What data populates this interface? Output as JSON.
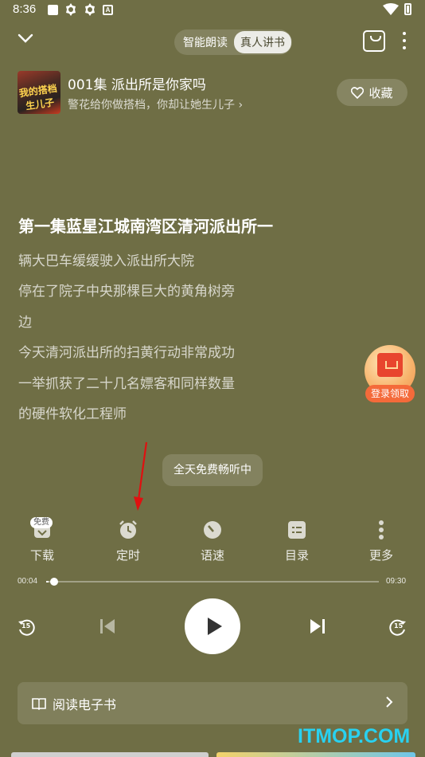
{
  "status_bar": {
    "time": "8:36",
    "a_label": "A"
  },
  "header": {
    "modes": [
      {
        "label": "智能朗读",
        "active": false
      },
      {
        "label": "真人讲书",
        "active": true
      }
    ]
  },
  "episode": {
    "title": "001集 派出所是你家吗",
    "subtitle": "警花给你做搭档，你却让她生儿子 ›",
    "cover_text": "我的搭档生儿子",
    "favorite_label": "收藏"
  },
  "content": {
    "heading": "第一集蓝星江城南湾区清河派出所一",
    "lines": [
      "辆大巴车缓缓驶入派出所大院",
      "停在了院子中央那棵巨大的黄角树旁",
      "边",
      "今天清河派出所的扫黄行动非常成功",
      "一举抓获了二十几名嫖客和同样数量",
      "的硬件软化工程师"
    ]
  },
  "reward": {
    "label": "登录领取"
  },
  "toast": "全天免费畅听中",
  "toolbar": {
    "items": [
      {
        "label": "下载",
        "badge": "免费",
        "icon": "download-icon"
      },
      {
        "label": "定时",
        "icon": "alarm-clock-icon"
      },
      {
        "label": "语速",
        "icon": "speed-gauge-icon"
      },
      {
        "label": "目录",
        "icon": "list-icon"
      },
      {
        "label": "更多",
        "icon": "more-vertical-icon"
      }
    ]
  },
  "progress": {
    "current": "00:04",
    "total": "09:30",
    "fraction": 0.007
  },
  "controls": {
    "rewind_seconds": "15",
    "forward_seconds": "15"
  },
  "ebook": {
    "label": "阅读电子书"
  },
  "watermark": "ITMOP.COM",
  "colors": {
    "background": "#6f6e45",
    "watermark": "#29d1f0",
    "reward": "#f46a3a"
  }
}
